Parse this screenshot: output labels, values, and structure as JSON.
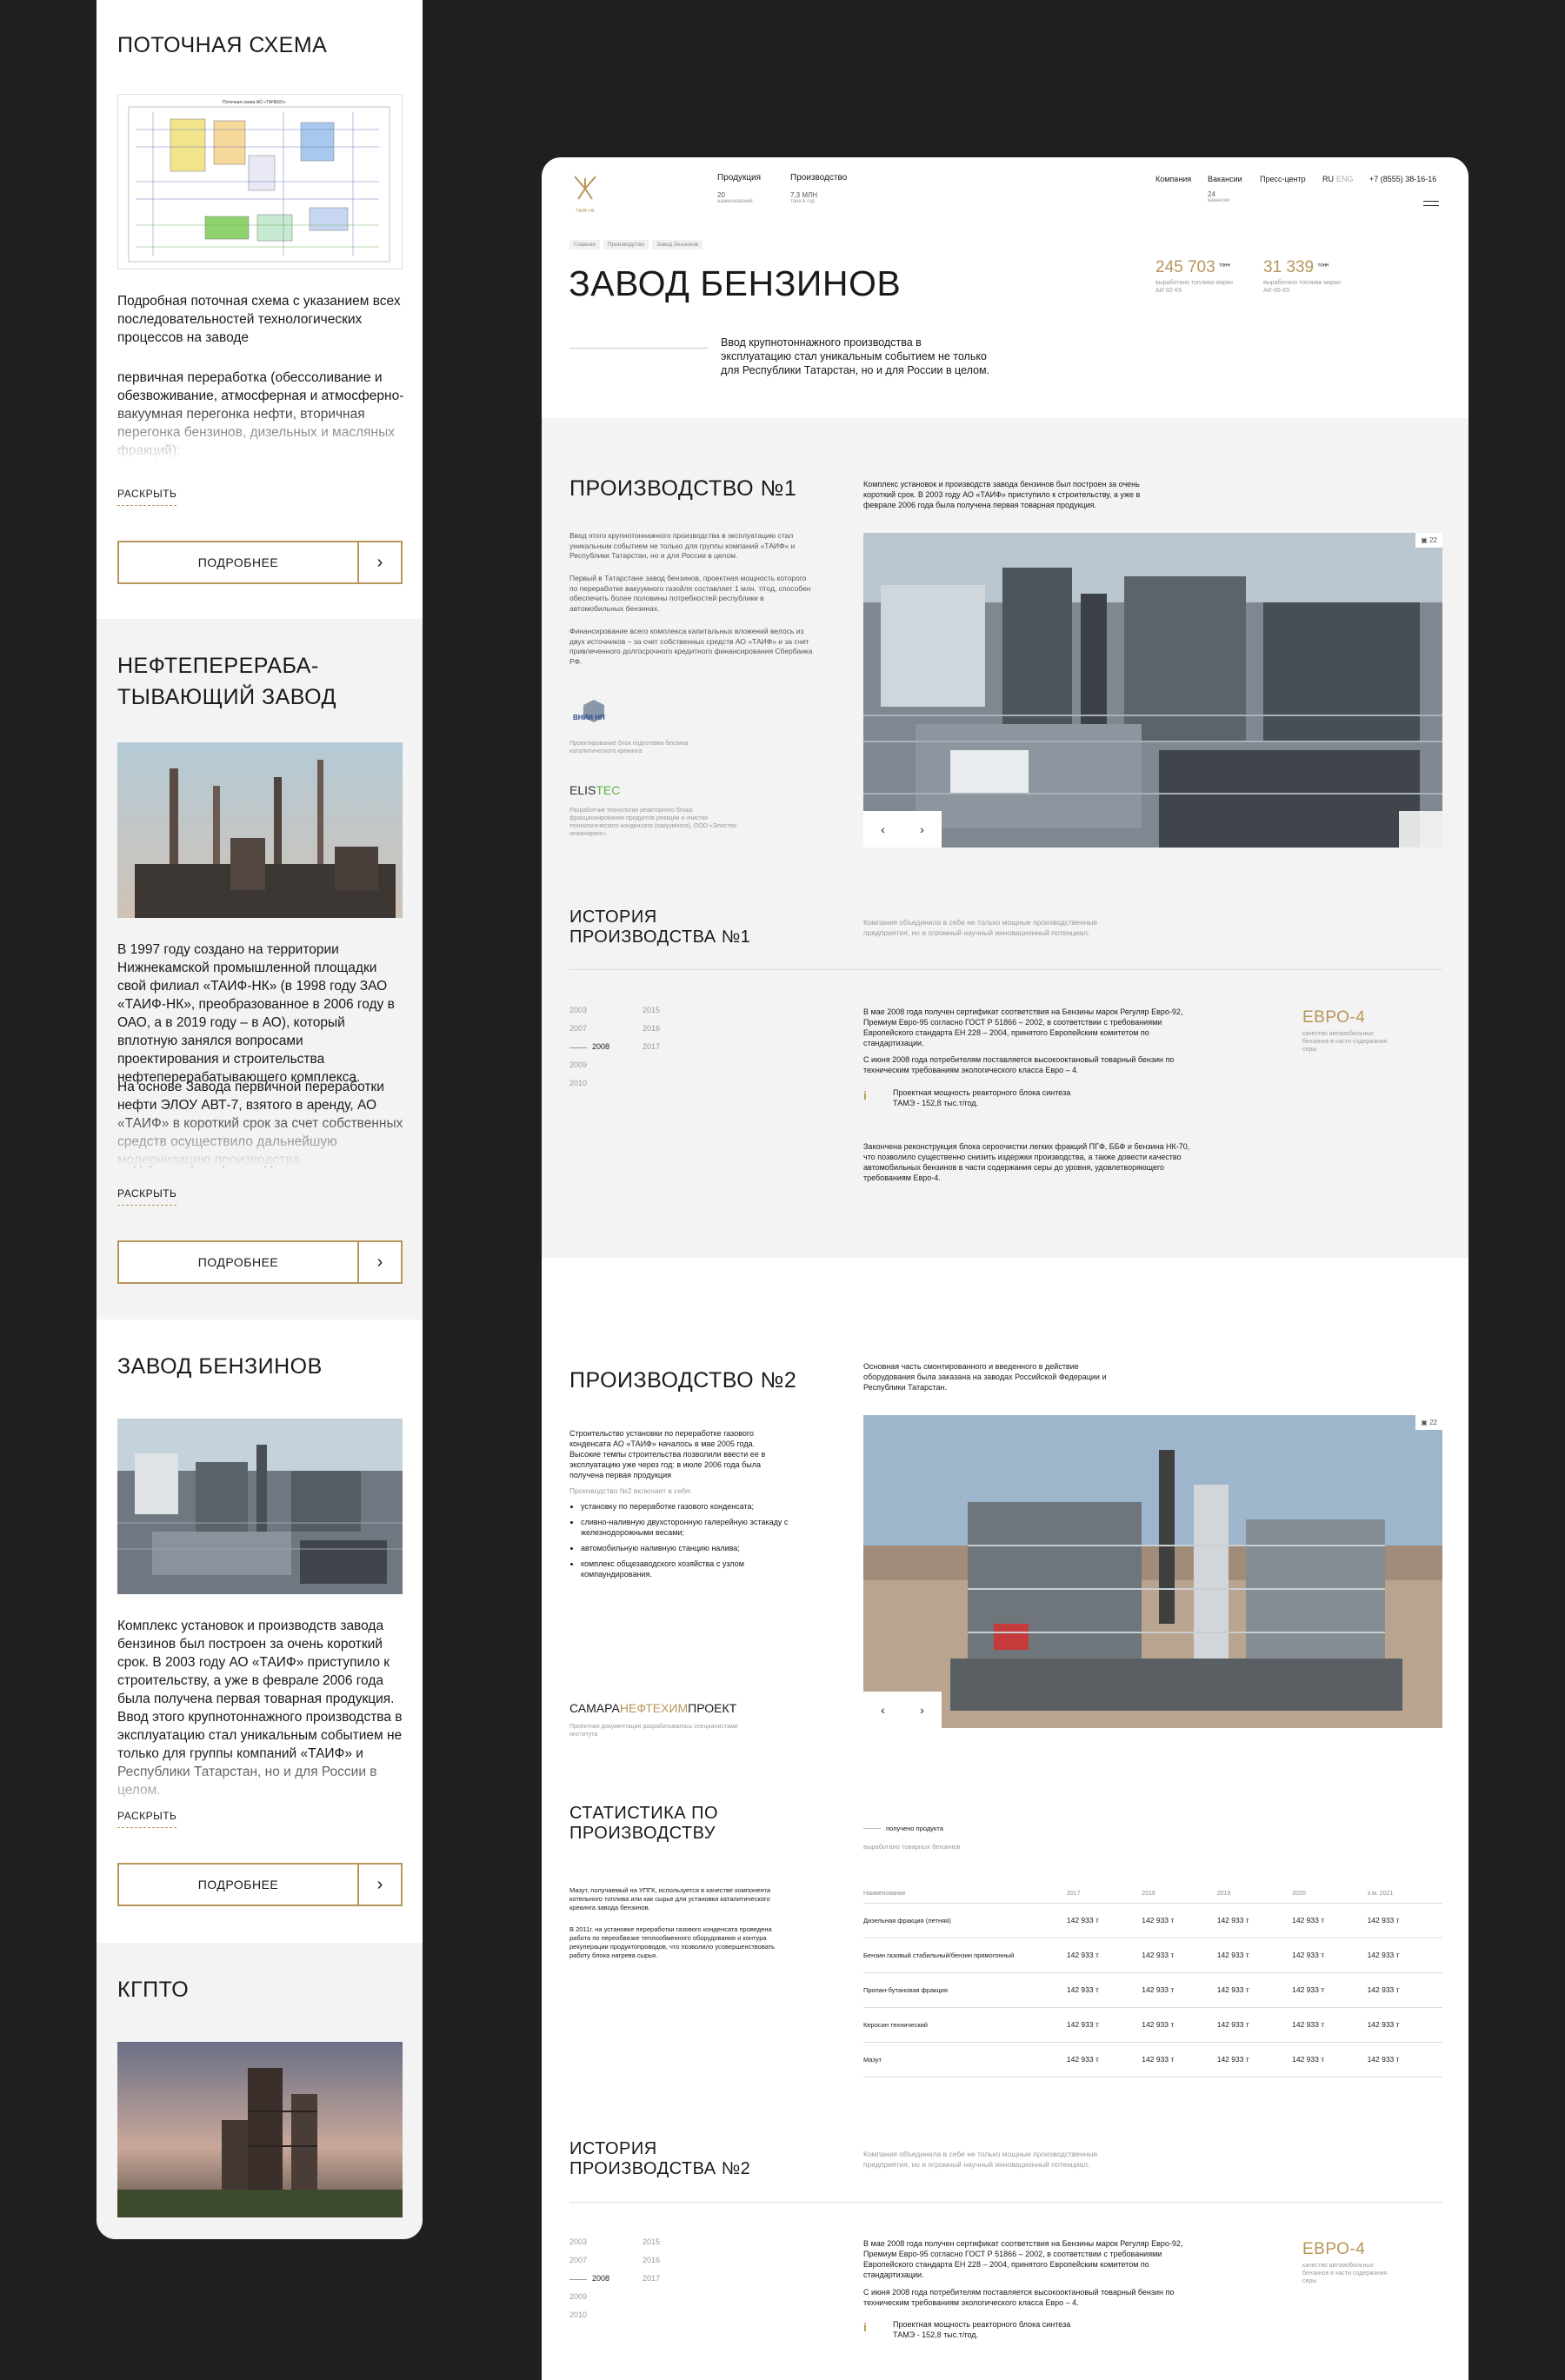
{
  "mobile": {
    "sections": [
      {
        "title": "ПОТОЧНАЯ СХЕМА",
        "text1": "Подробная поточная схема с указанием всех последовательностей технологических процессов на заводе",
        "text2": "первичная переработка (обессоливание и обезвоживание, атмосферная и атмосферно-вакуумная перегонка нефти, вторичная перегонка бензинов, дизельных и масляных фракций);",
        "more": "РАСКРЫТЬ",
        "button": "ПОДРОБНЕЕ",
        "scheme_title": "Поточная схема АО «ТАНЕКО»"
      },
      {
        "title": "НЕФТЕПЕРЕРАБА-ТЫВАЮЩИЙ ЗАВОД",
        "text1": "В 1997 году создано на территории Нижнекамской промышленной площадки свой филиал «ТАИФ-НК» (в 1998 году ЗАО «ТАИФ-НК», преобразованное в 2006 году в ОАО, а в 2019 году – в АО), который вплотную занялся вопросами проектирования и строительства нефтеперерабатывающего комплекса.",
        "text2": "На основе Завода первичной переработки нефти ЭЛОУ АВТ-7, взятого в аренду, АО «ТАИФ» в короткий срок за счет собственных средств осуществило дальнейшую модернизацию производства.",
        "more": "РАСКРЫТЬ",
        "button": "ПОДРОБНЕЕ"
      },
      {
        "title": "ЗАВОД БЕНЗИНОВ",
        "text1": "Комплекс установок и производств завода бензинов был построен за очень короткий срок. В 2003 году АО «ТАИФ» приступило к строительству, а уже в феврале 2006 года была получена первая товарная продукция. Ввод этого крупнотоннажного производства в эксплуатацию стал уникальным событием не только для группы компаний «ТАИФ» и Республики Татарстан, но и для России в целом.",
        "more": "РАСКРЫТЬ",
        "button": "ПОДРОБНЕЕ"
      },
      {
        "title": "КГПТО"
      }
    ]
  },
  "header": {
    "logo_caption": "ТАИФ-НК",
    "nav": [
      {
        "label": "Продукция",
        "num": "20",
        "sub": "наименований"
      },
      {
        "label": "Производство",
        "num": "7,3 МЛН",
        "sub": "тонн в год"
      }
    ],
    "right_nav": [
      {
        "label": "Компания"
      },
      {
        "label": "Вакансии",
        "num": "24",
        "sub": "вакансии"
      },
      {
        "label": "Пресс-центр"
      }
    ],
    "lang_ru": "RU",
    "lang_en": "ENG",
    "phone": "+7 (8555) 38-16-16"
  },
  "hero": {
    "breadcrumbs": [
      "Главная",
      "Производство",
      "Завод бензинов"
    ],
    "title": "ЗАВОД БЕНЗИНОВ",
    "lead": "Ввод крупнотоннажного производства в эксплуатацию стал уникальным событием не только для  Республики Татарстан, но и для России в целом.",
    "stats": [
      {
        "value": "245 703",
        "unit": "тонн",
        "desc": "выработано топлива марки АИ-92-К5"
      },
      {
        "value": "31 339",
        "unit": "тонн",
        "desc": "выработано топлива марки АИ-95-К5"
      }
    ]
  },
  "prod1": {
    "title": "ПРОИЗВОДСТВО №1",
    "intro": "Комплекс установок и производств завода бензинов был построен за очень короткий срок. В 2003 году АО «ТАИФ» приступило к строительству, а уже в феврале 2006 года была получена первая товарная продукция.",
    "p1": "Ввод этого крупнотоннажного производства в эксплуатацию стал уникальным событием не только для группы компаний «ТАИФ» и Республики Татарстан, но и для России в целом.",
    "p2": "Первый в Татарстане завод бензинов, проектная мощность которого по переработке вакуумного газойля составляет 1 млн. т/год, способен обеспечить более половины потребностей республики в автомобильных бензинах.",
    "p3": "Финансирование всего комплекса капитальных вложений велось из двух источников – за счет собственных средств АО «ТАИФ» и за счет привлеченного долгосрочного кредитного финансирования Сбербанка РФ.",
    "partner1_logo": "ВНИИ НП",
    "partner1_text": "Проектирование блок подготовки бензина каталитического крекинга",
    "partner2_logo_a": "ELIS",
    "partner2_logo_b": "TEC",
    "partner2_text": "Разработчик технологии реакторного блока фракционирования продуктов реакции и очистки технологического конденсата (вакуумного), ООО «Элистек-инжиниринг»",
    "photo_count": "22",
    "prev": "‹",
    "next": "›"
  },
  "history1": {
    "title": "ИСТОРИЯ ПРОИЗВОДСТВА №1",
    "sub": "Компания объединила в себе не только мощные производственные предприятия, но и огромный научный инновационный потенциал.",
    "years_col1": [
      "2003",
      "2007",
      "2008",
      "2009",
      "2010"
    ],
    "years_col2": [
      "2015",
      "2016",
      "2017"
    ],
    "active_year": "2008",
    "p1": "В мае 2008 года получен сертификат соответствия на Бензины марок Регуляр Евро-92, Премиум Евро-95 согласно ГОСТ Р 51866 – 2002, в соответствии с требованиями Европейского стандарта ЕН 228 – 2004, принятого Европейским комитетом по стандартизации.",
    "p2": "С июня 2008 года потребителям поставляется высокооктановый товарный бензин по техническим требованиям экологического класса Евро – 4.",
    "info": "Проектная мощность реакторного блока синтеза ТАМЭ - 152,8 тыс.т/год.",
    "p3": "Закончена реконструкция блока сероочистки легких фракций ПГФ, ББФ и бензина НК-70, что позволило существенно снизить издержки производства, а также довести качество автомобильных бензинов в части содержания серы до уровня, удовлетворяющего требованиям Евро-4.",
    "badge_title": "ЕВРО-4",
    "badge_text": "качество автомобильных бензинов в части содержания серы"
  },
  "prod2": {
    "title": "ПРОИЗВОДСТВО №2",
    "intro": "Основная часть смонтированного и введенного в действие оборудования была заказана на заводах Российской Федерации и Республики Татарстан.",
    "p1": "Строительство установки по переработке газового конденсата АО «ТАИФ» началось в мае 2005 года. Высокие темпы строительства позволили ввести ее в эксплуатацию уже через год: в июле 2006 года была получена первая продукция",
    "list_title": "Производство №2 включает в себя:",
    "list": [
      "установку по переработке газового конденсата;",
      "сливно-наливную двухсторонную галерейную эстакаду с железнодорожными весами;",
      "автомобильную наливную станцию налива;",
      "комплекс общезаводского хозяйства с узлом компаундирования."
    ],
    "partner_a": "САМАРА",
    "partner_b": "НЕФТЕХИМ",
    "partner_c": "ПРОЕКТ",
    "partner_text": "Проектная документация разрабатывалась специалистами института",
    "photo_count": "22",
    "prev": "‹",
    "next": "›"
  },
  "stats": {
    "title": "СТАТИСТИКА ПО ПРОИЗВОДСТВУ",
    "legend1": "получено продукта",
    "legend2": "выработано товарных бензинов",
    "p1": "Мазут, получаемый на УПГК, используется в качестве компонента котельного топлива или как сырье для установки каталитического крекинга завода бензинов.",
    "p2": "В 2011г. на установке переработки газового конденсата проведена работа по переобвязке теплообменного оборудования и контура рекуперации продуктопроводов, что позволило усовершенствовать работу блока нагрева сырья.",
    "columns": [
      "Наименование",
      "2017",
      "2018",
      "2019",
      "2020",
      "э.м. 2021"
    ],
    "rows": [
      {
        "name": "Дизельная фракция (летняя)",
        "vals": [
          "142 933 т",
          "142 933 т",
          "142 933 т",
          "142 933 т",
          "142 933 т"
        ]
      },
      {
        "name": "Бензин газовый стабильный/бензин прямогонный",
        "vals": [
          "142 933 т",
          "142 933 т",
          "142 933 т",
          "142 933 т",
          "142 933 т"
        ]
      },
      {
        "name": "Пропан-бутановая фракция",
        "vals": [
          "142 933 т",
          "142 933 т",
          "142 933 т",
          "142 933 т",
          "142 933 т"
        ]
      },
      {
        "name": "Керосин технический",
        "vals": [
          "142 933 т",
          "142 933 т",
          "142 933 т",
          "142 933 т",
          "142 933 т"
        ]
      },
      {
        "name": "Мазут",
        "vals": [
          "142 933 т",
          "142 933 т",
          "142 933 т",
          "142 933 т",
          "142 933 т"
        ]
      }
    ]
  },
  "history2": {
    "title": "ИСТОРИЯ ПРОИЗВОДСТВА №2",
    "sub": "Компания объединила в себе не только мощные производственные предприятия, но и огромный научный инновационный потенциал.",
    "years_col1": [
      "2003",
      "2007",
      "2008",
      "2009",
      "2010"
    ],
    "years_col2": [
      "2015",
      "2016",
      "2017"
    ],
    "active_year": "2008",
    "p1": "В мае 2008 года получен сертификат соответствия на Бензины марок Регуляр Евро-92, Премиум Евро-95 согласно ГОСТ Р 51866 – 2002, в соответствии с требованиями Европейского стандарта ЕН 228 – 2004, принятого Европейским комитетом по стандартизации.",
    "p2": "С июня 2008 года потребителям поставляется высокооктановый товарный бензин по техническим требованиям экологического класса Евро – 4.",
    "info": "Проектная мощность реакторного блока синтеза ТАМЭ - 152,8 тыс.т/год.",
    "badge_title": "ЕВРО-4",
    "badge_text": "качество автомобильных бензинов в части содержания серы"
  },
  "colors": {
    "accent": "#b8965a",
    "bg_dark": "#1f1f1f",
    "gray_bg": "#f3f3f3",
    "elis_green": "#5db844"
  }
}
